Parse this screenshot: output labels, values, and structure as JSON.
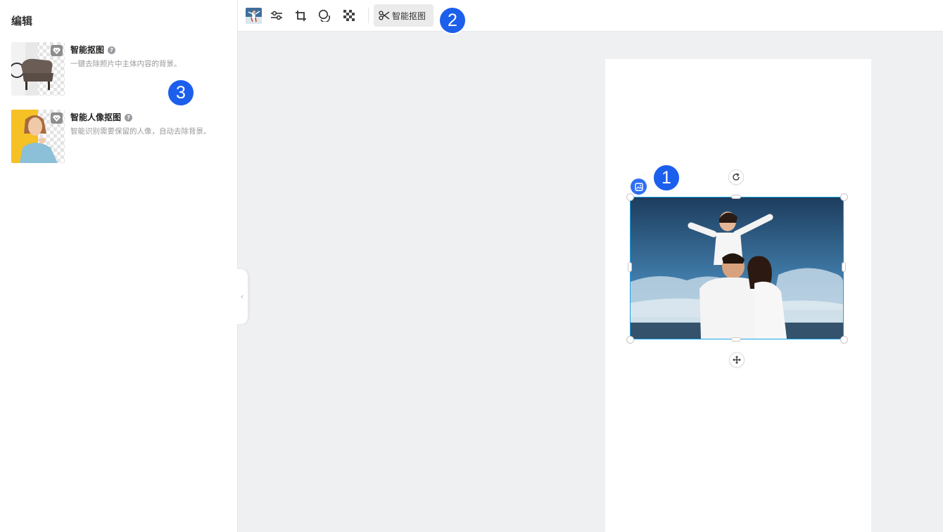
{
  "sidebar": {
    "title": "编辑",
    "tools": [
      {
        "name": "智能抠图",
        "description": "一键去除照片中主体内容的背景。",
        "help_icon": "question-circle-icon",
        "badge_icon": "vip-diamond-icon"
      },
      {
        "name": "智能人像抠图",
        "description": "智能识别需要保留的人像，自动去除背景。",
        "help_icon": "question-circle-icon",
        "badge_icon": "vip-diamond-icon"
      }
    ],
    "collapse_icon": "‹"
  },
  "toolbar": {
    "buttons": [
      {
        "name": "replace-image",
        "icon": "image-thumbnail-icon"
      },
      {
        "name": "adjust",
        "icon": "sliders-icon"
      },
      {
        "name": "crop",
        "icon": "crop-icon"
      },
      {
        "name": "mask-shape",
        "icon": "overlap-circles-icon"
      },
      {
        "name": "transparency",
        "icon": "checkerboard-icon"
      }
    ],
    "cutout_label": "智能抠图",
    "cutout_icon": "scissors-icon"
  },
  "markers": [
    "1",
    "2",
    "3"
  ],
  "colors": {
    "accent": "#2f6ff5",
    "selection": "#19a5e8",
    "marker": "#1c5fec",
    "canvas_bg": "#eff0f2"
  }
}
